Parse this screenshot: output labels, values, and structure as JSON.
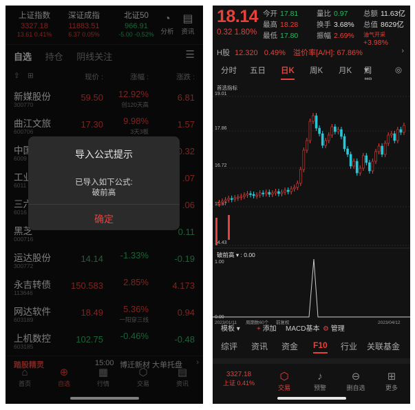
{
  "left": {
    "indices": [
      {
        "name": "上证指数",
        "value": "3327.18",
        "change": "13.61  0.41%",
        "color": "red"
      },
      {
        "name": "深证成指",
        "value": "11883.51",
        "change": "6.37  0.05%",
        "color": "red"
      },
      {
        "name": "北证50",
        "value": "966.91",
        "change": "-5.00  -0.52%",
        "color": "green"
      }
    ],
    "header_icons": [
      {
        "label": "分析",
        "icon": "pie-chart-icon"
      },
      {
        "label": "资讯",
        "icon": "news-icon"
      }
    ],
    "tabs": [
      "自选",
      "持仓",
      "阴线关注"
    ],
    "columns": {
      "price": "现价 :",
      "pct": "涨幅 :",
      "chg": "涨跌 :"
    },
    "stocks": [
      {
        "name": "新媒股份",
        "code": "300770",
        "price": "59.50",
        "pct": "12.92%",
        "note": "创120天高",
        "chg": "6.81",
        "color": "red"
      },
      {
        "name": "曲江文旅",
        "code": "600706",
        "price": "17.30",
        "pct": "9.98%",
        "note": "3天3板",
        "chg": "1.57",
        "color": "red"
      },
      {
        "name": "中国",
        "code": "6009",
        "price": "",
        "pct": "",
        "note": "",
        "chg": "0.32",
        "color": "red"
      },
      {
        "name": "工业",
        "code": "6011",
        "price": "",
        "pct": "",
        "note": "",
        "chg": ".07",
        "color": "red"
      },
      {
        "name": "三六",
        "code": "6016",
        "price": "",
        "pct": "",
        "note": "",
        "chg": ".06",
        "color": "red"
      },
      {
        "name": "黑芝",
        "code": "000716",
        "price": "",
        "pct": "",
        "note": "",
        "chg": "0.11",
        "color": "green"
      },
      {
        "name": "运达股份",
        "code": "300772",
        "price": "14.14",
        "pct": "-1.33%",
        "note": "",
        "chg": "-0.19",
        "color": "green"
      },
      {
        "name": "永吉转债",
        "code": "113646",
        "price": "150.583",
        "pct": "2.85%",
        "note": "",
        "chg": "4.173",
        "color": "red"
      },
      {
        "name": "网达软件",
        "code": "603189",
        "price": "18.49",
        "pct": "5.36%",
        "note": "一阳穿三线",
        "chg": "0.94",
        "color": "red"
      },
      {
        "name": "上机数控",
        "code": "603185",
        "price": "102.75",
        "pct": "-0.46%",
        "note": "",
        "chg": "-0.48",
        "color": "green"
      }
    ],
    "ticker": {
      "brand": "踏股精灵",
      "time": "15:00",
      "news": "博迁新材 大单托盘"
    },
    "nav": [
      {
        "label": "首页",
        "icon": "home-icon"
      },
      {
        "label": "自选",
        "icon": "plus-circle-icon",
        "active": true
      },
      {
        "label": "行情",
        "icon": "chart-icon"
      },
      {
        "label": "交易",
        "icon": "trade-icon"
      },
      {
        "label": "资讯",
        "icon": "news-icon"
      }
    ],
    "dialog": {
      "title": "导入公式提示",
      "line1": "已导入如下公式:",
      "line2": "破前高",
      "ok": "确定"
    }
  },
  "right": {
    "price": "18.14",
    "change": "0.32  1.80%",
    "stats": [
      {
        "k": "今开",
        "v": "17.81",
        "c": "green"
      },
      {
        "k": "量比",
        "v": "0.97",
        "c": "green"
      },
      {
        "k": "总额",
        "v": "11.63亿",
        "c": "white"
      },
      {
        "k": "最高",
        "v": "18.28",
        "c": "red"
      },
      {
        "k": "换手",
        "v": "3.68%",
        "c": "white"
      },
      {
        "k": "总值",
        "v": "8629亿",
        "c": "white"
      },
      {
        "k": "最低",
        "v": "17.80",
        "c": "green"
      },
      {
        "k": "振幅",
        "v": "2.69%",
        "c": "red"
      },
      {
        "k": "油气开采",
        "v": "+3.98%",
        "c": "red"
      }
    ],
    "hshare": {
      "label": "H股",
      "value": "12.320",
      "pct": "0.49%",
      "premium": "溢价率[A/H]: 67.86%"
    },
    "periods": [
      "分时",
      "五日",
      "日K",
      "周K",
      "月K",
      "周期"
    ],
    "chart_label": "首选指标",
    "y_ticks": [
      "19.01",
      "17.86",
      "16.72",
      "15.57",
      "14.43"
    ],
    "indicator": {
      "name": "破前高",
      "value": "0.00",
      "y_top": "1.00",
      "y_bot": "0.00"
    },
    "dates": {
      "start": "2023/01/11",
      "mid": "周期数60个",
      "mid2": "前复权",
      "end": "2023/04/12"
    },
    "toolbar": {
      "template": "模板",
      "add": "添加",
      "macd": "MACD基本",
      "manage": "管理"
    },
    "f10_tabs": [
      "综评",
      "资讯",
      "资金",
      "F10",
      "行业",
      "关联基金"
    ],
    "nav": [
      {
        "label": "3327.18",
        "sub": "上证 0.41%"
      },
      {
        "label": "交易",
        "icon": "trade-icon"
      },
      {
        "label": "预警",
        "icon": "bell-icon"
      },
      {
        "label": "删自选",
        "icon": "minus-circle-icon"
      },
      {
        "label": "更多",
        "icon": "grid-icon"
      }
    ]
  }
}
